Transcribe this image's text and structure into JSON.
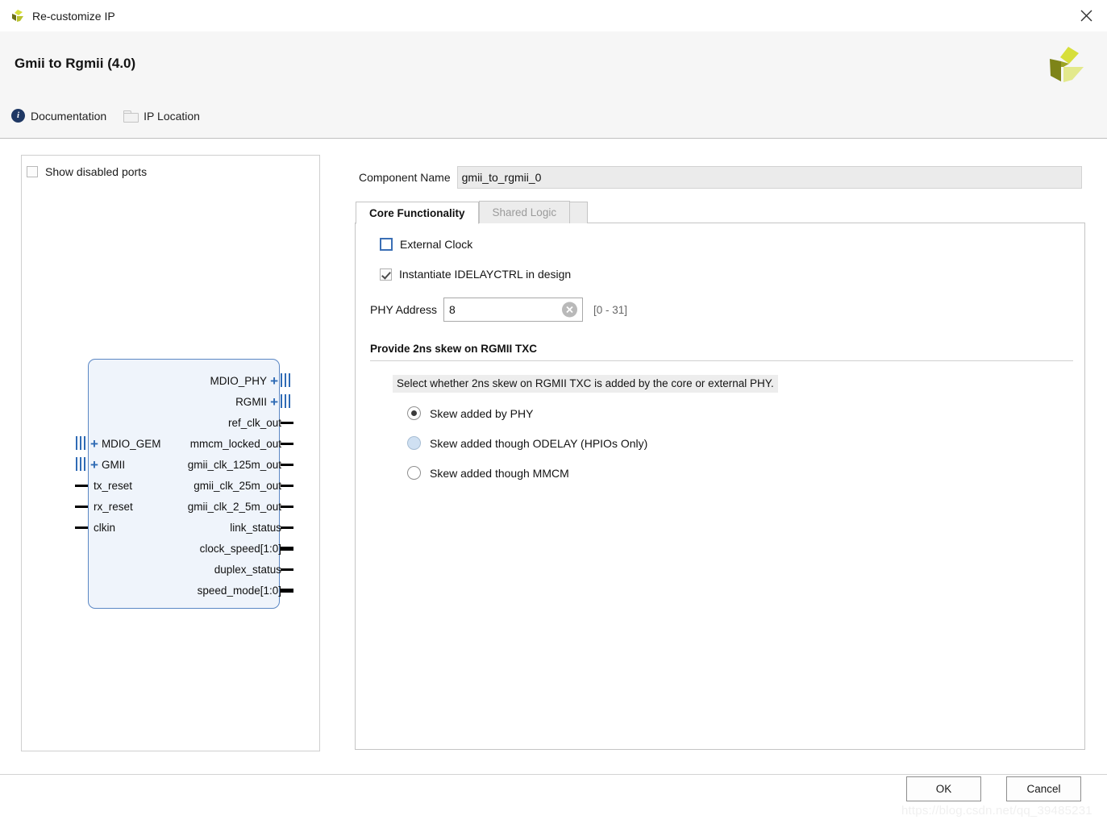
{
  "window": {
    "title": "Re-customize IP",
    "app_icon": "xilinx-logo-icon",
    "close_icon": "close-icon"
  },
  "header": {
    "ip_title": "Gmii to Rgmii (4.0)",
    "vendor_logo": "xilinx-pinwheel-logo",
    "links": [
      {
        "label": "Documentation",
        "icon": "info-icon"
      },
      {
        "label": "IP Location",
        "icon": "folder-icon"
      }
    ]
  },
  "left_panel": {
    "show_disabled_ports": {
      "label": "Show disabled ports",
      "checked": false
    },
    "block": {
      "right_ports": [
        {
          "name": "MDIO_PHY",
          "type": "bus",
          "expandable": true
        },
        {
          "name": "RGMII",
          "type": "bus",
          "expandable": true
        },
        {
          "name": "ref_clk_out",
          "type": "pin"
        },
        {
          "name": "mmcm_locked_out",
          "type": "pin"
        },
        {
          "name": "gmii_clk_125m_out",
          "type": "pin"
        },
        {
          "name": "gmii_clk_25m_out",
          "type": "pin"
        },
        {
          "name": "gmii_clk_2_5m_out",
          "type": "pin"
        },
        {
          "name": "link_status",
          "type": "pin"
        },
        {
          "name": "clock_speed[1:0]",
          "type": "pinbus"
        },
        {
          "name": "duplex_status",
          "type": "pin"
        },
        {
          "name": "speed_mode[1:0]",
          "type": "pinbus"
        }
      ],
      "left_ports": [
        {
          "name": "MDIO_GEM",
          "type": "bus",
          "expandable": true
        },
        {
          "name": "GMII",
          "type": "bus",
          "expandable": true
        },
        {
          "name": "tx_reset",
          "type": "pin"
        },
        {
          "name": "rx_reset",
          "type": "pin"
        },
        {
          "name": "clkin",
          "type": "pin"
        }
      ]
    }
  },
  "right_panel": {
    "component_name": {
      "label": "Component Name",
      "value": "gmii_to_rgmii_0"
    },
    "tabs": [
      {
        "label": "Core Functionality",
        "active": true,
        "disabled": false
      },
      {
        "label": "Shared Logic",
        "active": false,
        "disabled": true
      }
    ],
    "external_clock": {
      "label": "External Clock",
      "checked": false
    },
    "instantiate_idelayctrl": {
      "label": "Instantiate IDELAYCTRL in design",
      "checked": true
    },
    "phy_address": {
      "label": "PHY Address",
      "value": "8",
      "range": "[0 - 31]",
      "clear_icon": "clear-circle-icon"
    },
    "skew_section": {
      "title": "Provide 2ns skew on RGMII TXC",
      "help": "Select whether 2ns skew on RGMII TXC is added by the core or external PHY.",
      "options": [
        {
          "label": "Skew added by PHY",
          "selected": true,
          "hover": false
        },
        {
          "label": "Skew added though ODELAY (HPIOs Only)",
          "selected": false,
          "hover": true
        },
        {
          "label": "Skew added though MMCM",
          "selected": false,
          "hover": false
        }
      ]
    }
  },
  "footer": {
    "ok_label": "OK",
    "cancel_label": "Cancel",
    "watermark": "https://blog.csdn.net/qq_39485231"
  },
  "colors": {
    "accent_blue": "#3b6fb5",
    "block_fill": "#eff4fb",
    "block_border": "#5b87c4",
    "header_bg": "#f6f6f6",
    "logo_olive": "#8a8f1f",
    "logo_yellow": "#d7df3a"
  }
}
